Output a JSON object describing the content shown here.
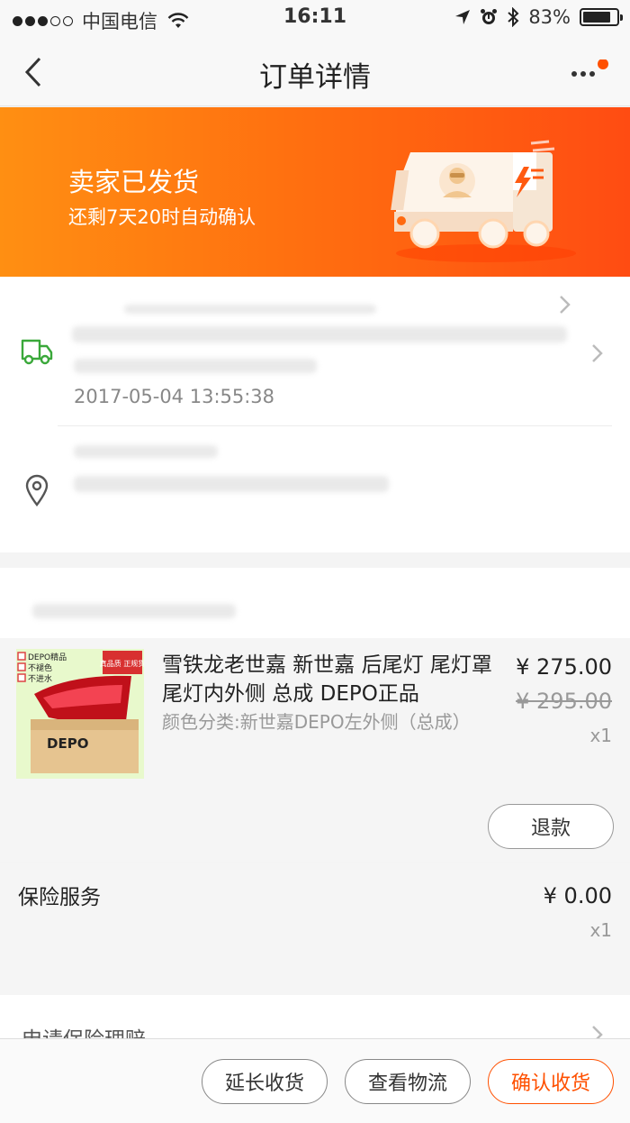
{
  "status_bar": {
    "carrier": "中国电信",
    "time": "16:11",
    "battery_text": "83%",
    "battery_level": 0.83
  },
  "nav": {
    "title": "订单详情"
  },
  "banner": {
    "status": "卖家已发货",
    "countdown": "还剩7天20时自动确认"
  },
  "logistics": {
    "time": "2017-05-04 13:55:38"
  },
  "product": {
    "name": "雪铁龙老世嘉 新世嘉 后尾灯 尾灯罩 尾灯内外侧 总成 DEPO正品",
    "sku": "颜色分类:新世嘉DEPO左外侧（总成）",
    "price": "¥ 275.00",
    "original_price": "¥ 295.00",
    "quantity": "x1",
    "refund_label": "退款",
    "image_badges": [
      "DEPO精品",
      "不褪色",
      "不进水"
    ],
    "image_stamp": "真品质 正规货",
    "image_box_text": "DEPO"
  },
  "insurance": {
    "label": "保险服务",
    "price": "¥ 0.00",
    "quantity": "x1"
  },
  "claim": {
    "label": "申请保险理赔"
  },
  "actions": {
    "extend": "延长收货",
    "logistics": "查看物流",
    "confirm": "确认收货"
  },
  "colors": {
    "accent": "#ff5000",
    "banner_start": "#ff8f12",
    "banner_end": "#ff4c12",
    "location_green": "#3aa83a"
  }
}
